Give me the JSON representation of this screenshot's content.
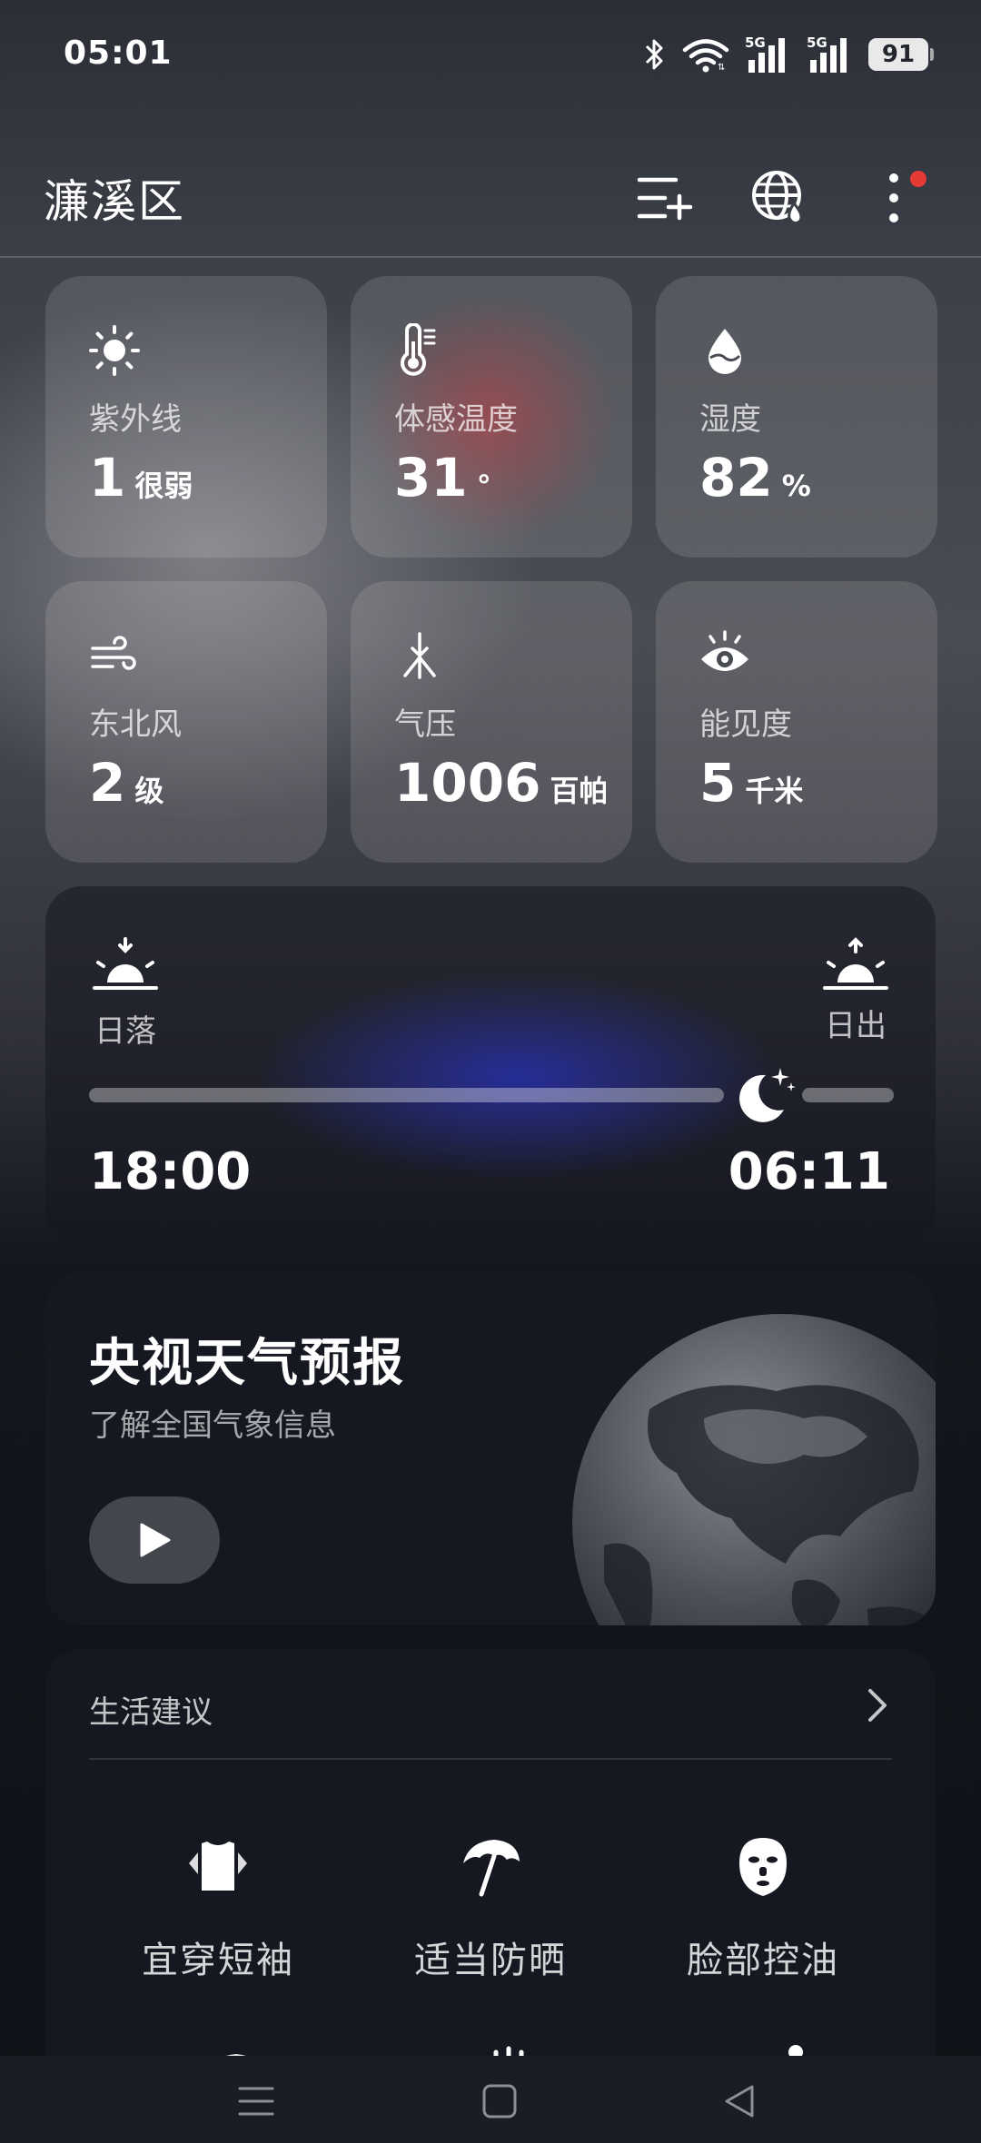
{
  "status_bar": {
    "time": "05:01",
    "battery": "91"
  },
  "header": {
    "location": "濂溪区"
  },
  "metrics": [
    {
      "icon": "sun-icon",
      "label": "紫外线",
      "value": "1",
      "unit": "很弱"
    },
    {
      "icon": "thermometer-icon",
      "label": "体感温度",
      "value": "31",
      "unit": "°"
    },
    {
      "icon": "droplet-icon",
      "label": "湿度",
      "value": "82",
      "unit": "%"
    },
    {
      "icon": "wind-icon",
      "label": "东北风",
      "value": "2",
      "unit": "级"
    },
    {
      "icon": "pressure-icon",
      "label": "气压",
      "value": "1006",
      "unit": "百帕"
    },
    {
      "icon": "eye-icon",
      "label": "能见度",
      "value": "5",
      "unit": "千米"
    }
  ],
  "sun": {
    "sunset_label": "日落",
    "sunrise_label": "日出",
    "sunset_time": "18:00",
    "sunrise_time": "06:11",
    "night_progress": 0.8
  },
  "forecast": {
    "title": "央视天气预报",
    "subtitle": "了解全国气象信息"
  },
  "life": {
    "title": "生活建议",
    "items": [
      {
        "icon": "tshirt-icon",
        "label": "宜穿短袖"
      },
      {
        "icon": "umbrella-icon",
        "label": "适当防晒"
      },
      {
        "icon": "face-mask-icon",
        "label": "脸部控油"
      }
    ]
  },
  "colors": {
    "notification_dot": "#e53935",
    "glow_blue": "#2830aa",
    "glow_red": "#be282d"
  }
}
